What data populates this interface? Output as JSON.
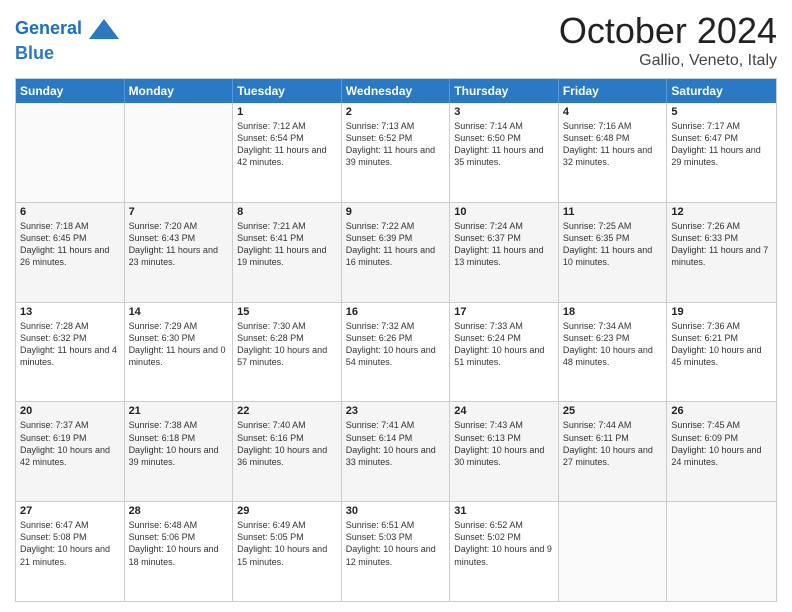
{
  "header": {
    "logo_line1": "General",
    "logo_line2": "Blue",
    "month": "October 2024",
    "location": "Gallio, Veneto, Italy"
  },
  "days_of_week": [
    "Sunday",
    "Monday",
    "Tuesday",
    "Wednesday",
    "Thursday",
    "Friday",
    "Saturday"
  ],
  "weeks": [
    [
      {
        "day": "",
        "info": ""
      },
      {
        "day": "",
        "info": ""
      },
      {
        "day": "1",
        "info": "Sunrise: 7:12 AM\nSunset: 6:54 PM\nDaylight: 11 hours and 42 minutes."
      },
      {
        "day": "2",
        "info": "Sunrise: 7:13 AM\nSunset: 6:52 PM\nDaylight: 11 hours and 39 minutes."
      },
      {
        "day": "3",
        "info": "Sunrise: 7:14 AM\nSunset: 6:50 PM\nDaylight: 11 hours and 35 minutes."
      },
      {
        "day": "4",
        "info": "Sunrise: 7:16 AM\nSunset: 6:48 PM\nDaylight: 11 hours and 32 minutes."
      },
      {
        "day": "5",
        "info": "Sunrise: 7:17 AM\nSunset: 6:47 PM\nDaylight: 11 hours and 29 minutes."
      }
    ],
    [
      {
        "day": "6",
        "info": "Sunrise: 7:18 AM\nSunset: 6:45 PM\nDaylight: 11 hours and 26 minutes."
      },
      {
        "day": "7",
        "info": "Sunrise: 7:20 AM\nSunset: 6:43 PM\nDaylight: 11 hours and 23 minutes."
      },
      {
        "day": "8",
        "info": "Sunrise: 7:21 AM\nSunset: 6:41 PM\nDaylight: 11 hours and 19 minutes."
      },
      {
        "day": "9",
        "info": "Sunrise: 7:22 AM\nSunset: 6:39 PM\nDaylight: 11 hours and 16 minutes."
      },
      {
        "day": "10",
        "info": "Sunrise: 7:24 AM\nSunset: 6:37 PM\nDaylight: 11 hours and 13 minutes."
      },
      {
        "day": "11",
        "info": "Sunrise: 7:25 AM\nSunset: 6:35 PM\nDaylight: 11 hours and 10 minutes."
      },
      {
        "day": "12",
        "info": "Sunrise: 7:26 AM\nSunset: 6:33 PM\nDaylight: 11 hours and 7 minutes."
      }
    ],
    [
      {
        "day": "13",
        "info": "Sunrise: 7:28 AM\nSunset: 6:32 PM\nDaylight: 11 hours and 4 minutes."
      },
      {
        "day": "14",
        "info": "Sunrise: 7:29 AM\nSunset: 6:30 PM\nDaylight: 11 hours and 0 minutes."
      },
      {
        "day": "15",
        "info": "Sunrise: 7:30 AM\nSunset: 6:28 PM\nDaylight: 10 hours and 57 minutes."
      },
      {
        "day": "16",
        "info": "Sunrise: 7:32 AM\nSunset: 6:26 PM\nDaylight: 10 hours and 54 minutes."
      },
      {
        "day": "17",
        "info": "Sunrise: 7:33 AM\nSunset: 6:24 PM\nDaylight: 10 hours and 51 minutes."
      },
      {
        "day": "18",
        "info": "Sunrise: 7:34 AM\nSunset: 6:23 PM\nDaylight: 10 hours and 48 minutes."
      },
      {
        "day": "19",
        "info": "Sunrise: 7:36 AM\nSunset: 6:21 PM\nDaylight: 10 hours and 45 minutes."
      }
    ],
    [
      {
        "day": "20",
        "info": "Sunrise: 7:37 AM\nSunset: 6:19 PM\nDaylight: 10 hours and 42 minutes."
      },
      {
        "day": "21",
        "info": "Sunrise: 7:38 AM\nSunset: 6:18 PM\nDaylight: 10 hours and 39 minutes."
      },
      {
        "day": "22",
        "info": "Sunrise: 7:40 AM\nSunset: 6:16 PM\nDaylight: 10 hours and 36 minutes."
      },
      {
        "day": "23",
        "info": "Sunrise: 7:41 AM\nSunset: 6:14 PM\nDaylight: 10 hours and 33 minutes."
      },
      {
        "day": "24",
        "info": "Sunrise: 7:43 AM\nSunset: 6:13 PM\nDaylight: 10 hours and 30 minutes."
      },
      {
        "day": "25",
        "info": "Sunrise: 7:44 AM\nSunset: 6:11 PM\nDaylight: 10 hours and 27 minutes."
      },
      {
        "day": "26",
        "info": "Sunrise: 7:45 AM\nSunset: 6:09 PM\nDaylight: 10 hours and 24 minutes."
      }
    ],
    [
      {
        "day": "27",
        "info": "Sunrise: 6:47 AM\nSunset: 5:08 PM\nDaylight: 10 hours and 21 minutes."
      },
      {
        "day": "28",
        "info": "Sunrise: 6:48 AM\nSunset: 5:06 PM\nDaylight: 10 hours and 18 minutes."
      },
      {
        "day": "29",
        "info": "Sunrise: 6:49 AM\nSunset: 5:05 PM\nDaylight: 10 hours and 15 minutes."
      },
      {
        "day": "30",
        "info": "Sunrise: 6:51 AM\nSunset: 5:03 PM\nDaylight: 10 hours and 12 minutes."
      },
      {
        "day": "31",
        "info": "Sunrise: 6:52 AM\nSunset: 5:02 PM\nDaylight: 10 hours and 9 minutes."
      },
      {
        "day": "",
        "info": ""
      },
      {
        "day": "",
        "info": ""
      }
    ]
  ]
}
